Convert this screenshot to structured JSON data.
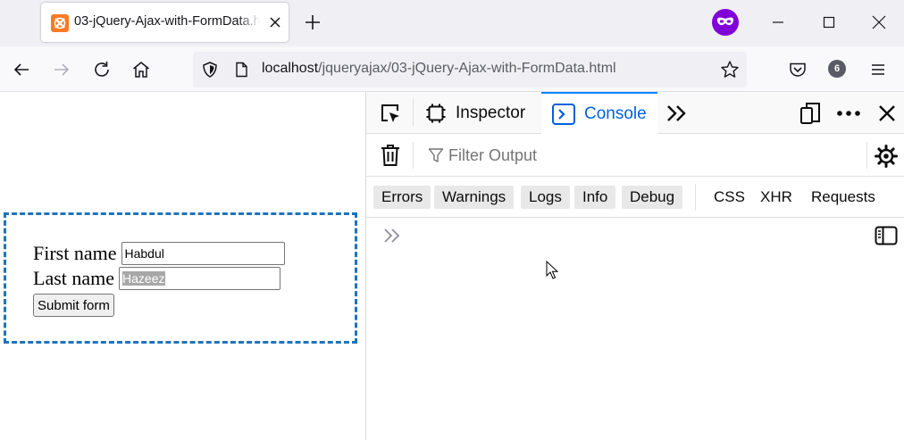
{
  "browser": {
    "tab_title": "03-jQuery-Ajax-with-FormData.html",
    "url_host": "localhost",
    "url_path": "/jqueryajax/03-jQuery-Ajax-with-FormData.html",
    "extensions_count": "6",
    "private_badge_color": "#8000d7",
    "favicon_color": "#fb7a24"
  },
  "page": {
    "first_name_label": "First name",
    "first_name_value": "Habdul",
    "last_name_label": "Last name",
    "last_name_value": "Hazeez",
    "submit_label": "Submit form",
    "border_color": "#1e73be"
  },
  "devtools": {
    "tabs": [
      {
        "label": "Inspector"
      },
      {
        "label": "Console",
        "active": true
      }
    ],
    "filter_placeholder": "Filter Output",
    "levels": [
      {
        "label": "Errors",
        "enabled": true
      },
      {
        "label": "Warnings",
        "enabled": true
      },
      {
        "label": "Logs",
        "enabled": true
      },
      {
        "label": "Info",
        "enabled": true
      },
      {
        "label": "Debug",
        "enabled": true
      }
    ],
    "requests": [
      {
        "label": "CSS"
      },
      {
        "label": "XHR"
      },
      {
        "label": "Requests"
      }
    ],
    "accent_color": "#0060df"
  }
}
